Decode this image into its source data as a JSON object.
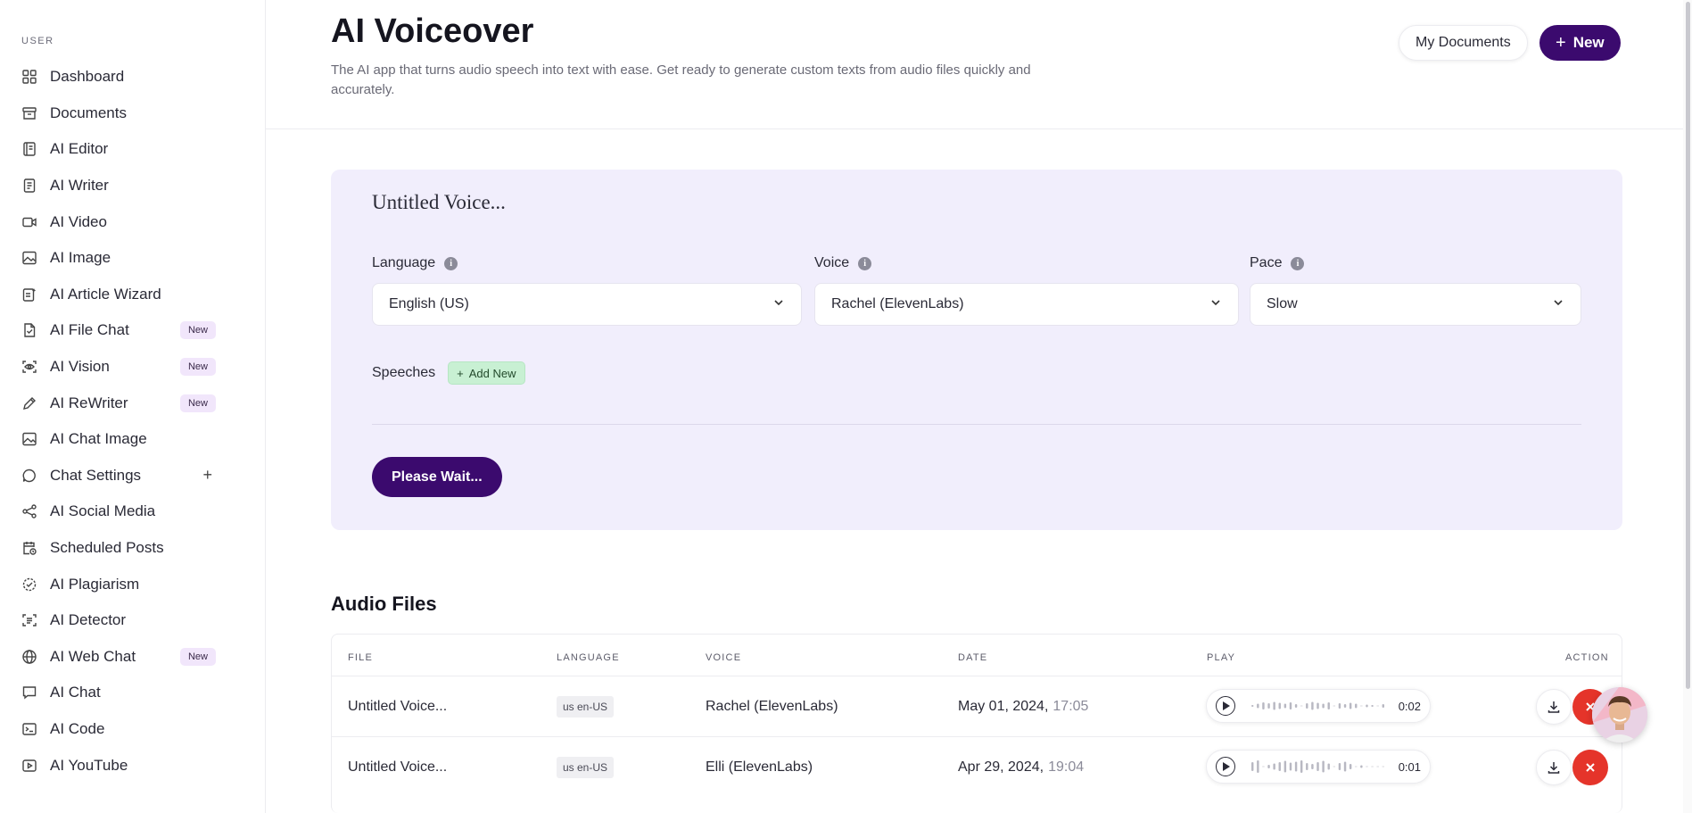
{
  "sidebar": {
    "section_label": "USER",
    "items": [
      {
        "label": "Dashboard",
        "icon": "dashboard-icon",
        "badge": ""
      },
      {
        "label": "Documents",
        "icon": "archive-icon",
        "badge": ""
      },
      {
        "label": "AI Editor",
        "icon": "editor-icon",
        "badge": ""
      },
      {
        "label": "AI Writer",
        "icon": "document-icon",
        "badge": ""
      },
      {
        "label": "AI Video",
        "icon": "video-icon",
        "badge": ""
      },
      {
        "label": "AI Image",
        "icon": "image-icon",
        "badge": ""
      },
      {
        "label": "AI Article Wizard",
        "icon": "ai-text-icon",
        "badge": ""
      },
      {
        "label": "AI File Chat",
        "icon": "file-icon",
        "badge": "New"
      },
      {
        "label": "AI Vision",
        "icon": "eye-scan-icon",
        "badge": "New"
      },
      {
        "label": "AI ReWriter",
        "icon": "pen-icon",
        "badge": "New"
      },
      {
        "label": "AI Chat Image",
        "icon": "image-icon",
        "badge": ""
      },
      {
        "label": "Chat Settings",
        "icon": "chat-bubble-icon",
        "badge": "",
        "expand": "+"
      },
      {
        "label": "AI Social Media",
        "icon": "share-icon",
        "badge": ""
      },
      {
        "label": "Scheduled Posts",
        "icon": "calendar-clock-icon",
        "badge": ""
      },
      {
        "label": "AI Plagiarism",
        "icon": "check-circle-icon",
        "badge": ""
      },
      {
        "label": "AI Detector",
        "icon": "scan-text-icon",
        "badge": ""
      },
      {
        "label": "AI Web Chat",
        "icon": "globe-icon",
        "badge": "New"
      },
      {
        "label": "AI Chat",
        "icon": "message-icon",
        "badge": ""
      },
      {
        "label": "AI Code",
        "icon": "terminal-icon",
        "badge": ""
      },
      {
        "label": "AI YouTube",
        "icon": "youtube-icon",
        "badge": ""
      }
    ]
  },
  "header": {
    "title": "AI Voiceover",
    "description": "The AI app that turns audio speech into text with ease. Get ready to generate custom texts from audio files quickly and accurately.",
    "my_documents_label": "My Documents",
    "new_label": "New"
  },
  "form": {
    "voice_title": "Untitled Voice...",
    "language_label": "Language",
    "language_value": "English (US)",
    "voice_label": "Voice",
    "voice_value": "Rachel (ElevenLabs)",
    "pace_label": "Pace",
    "pace_value": "Slow",
    "speeches_label": "Speeches",
    "add_new_label": "Add New",
    "submit_label": "Please Wait..."
  },
  "audio_files": {
    "title": "Audio Files",
    "columns": {
      "file": "FILE",
      "language": "LANGUAGE",
      "voice": "VOICE",
      "date": "DATE",
      "play": "PLAY",
      "action": "ACTION"
    },
    "rows": [
      {
        "file": "Untitled Voice...",
        "language": "us en-US",
        "voice": "Rachel (ElevenLabs)",
        "date": "May 01, 2024,",
        "time": "17:05",
        "duration": "0:02"
      },
      {
        "file": "Untitled Voice...",
        "language": "us en-US",
        "voice": "Elli (ElevenLabs)",
        "date": "Apr 29, 2024,",
        "time": "19:04",
        "duration": "0:01"
      }
    ]
  },
  "colors": {
    "primary": "#3b0a6e",
    "card_bg": "#f1eefc",
    "badge_new": "#f1e6fb",
    "add_new_bg": "#c8f0d3",
    "delete": "#e5342a"
  }
}
